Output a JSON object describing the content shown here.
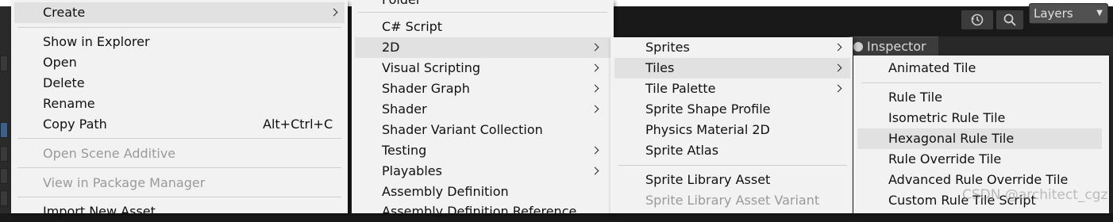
{
  "toolbar": {
    "history_icon": "history-icon",
    "search_icon": "search-icon",
    "layers_label": "Layers"
  },
  "inspector": {
    "tab_label": "Inspector"
  },
  "menu_create": {
    "create": "Create",
    "show_in_explorer": "Show in Explorer",
    "open": "Open",
    "delete": "Delete",
    "rename": "Rename",
    "copy_path": "Copy Path",
    "copy_path_shortcut": "Alt+Ctrl+C",
    "open_scene_additive": "Open Scene Additive",
    "view_in_package_manager": "View in Package Manager",
    "import_new_asset": "Import New Asset..."
  },
  "menu_assets": {
    "folder": "Folder",
    "csharp_script": "C# Script",
    "two_d": "2D",
    "visual_scripting": "Visual Scripting",
    "shader_graph": "Shader Graph",
    "shader": "Shader",
    "shader_variant_collection": "Shader Variant Collection",
    "testing": "Testing",
    "playables": "Playables",
    "assembly_definition": "Assembly Definition",
    "assembly_definition_reference": "Assembly Definition Reference"
  },
  "menu_2d": {
    "sprites": "Sprites",
    "tiles": "Tiles",
    "tile_palette": "Tile Palette",
    "sprite_shape_profile": "Sprite Shape Profile",
    "physics_material_2d": "Physics Material 2D",
    "sprite_atlas": "Sprite Atlas",
    "sprite_library_asset": "Sprite Library Asset",
    "sprite_library_asset_variant": "Sprite Library Asset Variant"
  },
  "menu_tiles": {
    "animated_tile": "Animated Tile",
    "rule_tile": "Rule Tile",
    "isometric_rule_tile": "Isometric Rule Tile",
    "hexagonal_rule_tile": "Hexagonal Rule Tile",
    "rule_override_tile": "Rule Override Tile",
    "advanced_rule_override_tile": "Advanced Rule Override Tile",
    "custom_rule_tile_script": "Custom Rule Tile Script"
  },
  "watermark": "CSDN @architect_cgz"
}
